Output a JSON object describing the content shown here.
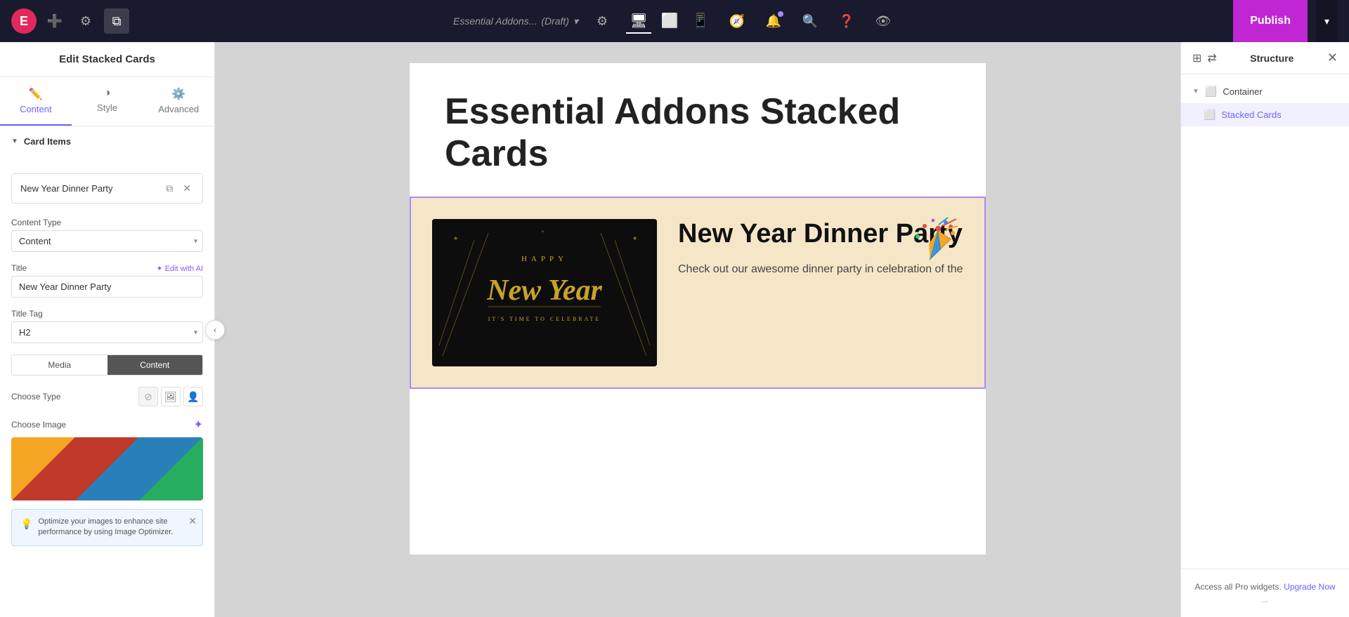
{
  "toolbar": {
    "logo_letter": "E",
    "site_name": "Essential Addons...",
    "site_status": "(Draft)",
    "publish_label": "Publish",
    "devices": [
      {
        "id": "desktop",
        "icon": "🖥",
        "active": true
      },
      {
        "id": "tablet",
        "icon": "⬜",
        "active": false
      },
      {
        "id": "mobile",
        "icon": "📱",
        "active": false
      }
    ]
  },
  "left_panel": {
    "header": "Edit Stacked Cards",
    "tabs": [
      {
        "id": "content",
        "label": "Content",
        "icon": "✏️",
        "active": true
      },
      {
        "id": "style",
        "label": "Style",
        "icon": "◑",
        "active": false
      },
      {
        "id": "advanced",
        "label": "Advanced",
        "icon": "⚙️",
        "active": false
      }
    ],
    "sections": [
      {
        "id": "card-items",
        "label": "Card Items",
        "expanded": true
      }
    ],
    "card_item": {
      "title": "New Year Dinner Party",
      "content_type_label": "Content Type",
      "content_type_value": "Content",
      "title_label": "Title",
      "edit_ai_label": "✦ Edit with AI",
      "title_value": "New Year Dinner Party",
      "title_tag_label": "Title Tag",
      "title_tag_value": "H2",
      "media_label": "Media",
      "content_label": "Content",
      "choose_type_label": "Choose Type",
      "choose_image_label": "Choose Image"
    },
    "optimize_banner": {
      "text": "Optimize your images to enhance site performance by using Image Optimizer."
    }
  },
  "canvas": {
    "page_title": "Essential Addons Stacked Cards",
    "card": {
      "title": "New Year Dinner Party",
      "description": "Check out our awesome dinner party in celebration of the",
      "party_icon": "🎉"
    },
    "happy_new_year_lines": [
      "HAPPY",
      "New Year",
      "IT'S TIME TO CELEBRATE"
    ]
  },
  "right_panel": {
    "title": "Structure",
    "tree": [
      {
        "id": "container",
        "label": "Container",
        "icon": "▣",
        "level": 0,
        "expanded": true
      },
      {
        "id": "stacked-cards",
        "label": "Stacked Cards",
        "icon": "▣",
        "level": 1,
        "selected": true
      }
    ],
    "upgrade_text": "Access all Pro widgets.",
    "upgrade_link": "Upgrade Now",
    "upgrade_dots": "..."
  }
}
